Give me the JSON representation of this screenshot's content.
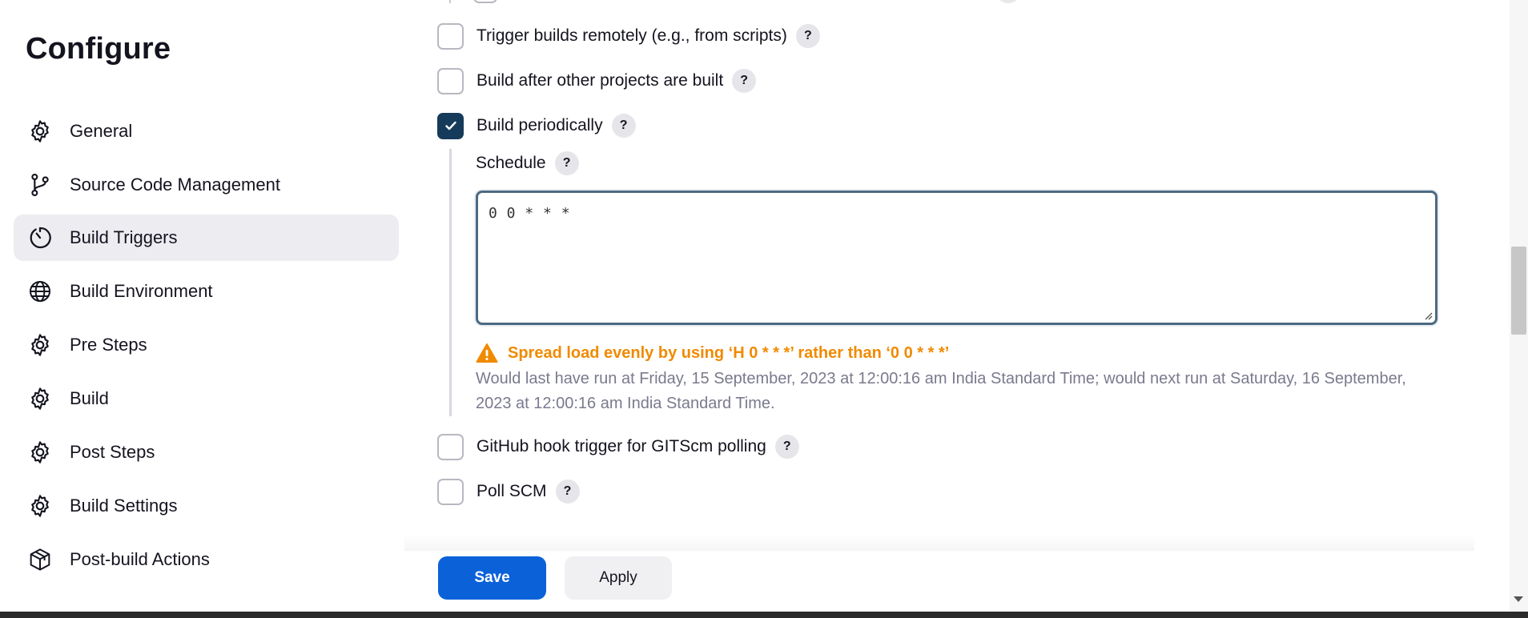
{
  "sidebar": {
    "title": "Configure",
    "items": [
      {
        "label": "General",
        "icon": "gear-icon"
      },
      {
        "label": "Source Code Management",
        "icon": "branch-icon"
      },
      {
        "label": "Build Triggers",
        "icon": "clock-icon",
        "active": true
      },
      {
        "label": "Build Environment",
        "icon": "globe-icon"
      },
      {
        "label": "Pre Steps",
        "icon": "gear-icon"
      },
      {
        "label": "Build",
        "icon": "gear-icon"
      },
      {
        "label": "Post Steps",
        "icon": "gear-icon"
      },
      {
        "label": "Build Settings",
        "icon": "gear-icon"
      },
      {
        "label": "Post-build Actions",
        "icon": "package-icon"
      }
    ]
  },
  "triggers": [
    {
      "label": "Trigger builds remotely (e.g., from scripts)",
      "checked": false,
      "help": "?"
    },
    {
      "label": "Build after other projects are built",
      "checked": false,
      "help": "?"
    },
    {
      "label": "Build periodically",
      "checked": true,
      "help": "?"
    },
    {
      "label": "GitHub hook trigger for GITScm polling",
      "checked": false,
      "help": "?"
    },
    {
      "label": "Poll SCM",
      "checked": false,
      "help": "?"
    }
  ],
  "schedule": {
    "label": "Schedule",
    "help": "?",
    "value": "0 0 * * *",
    "warning": "Spread load evenly by using ‘H 0 * * *’ rather than ‘0 0 * * *’",
    "run_info": "Would last have run at Friday, 15 September, 2023 at 12:00:16 am India Standard Time; would next run at Saturday, 16 September, 2023 at 12:00:16 am India Standard Time."
  },
  "actions": {
    "save_label": "Save",
    "apply_label": "Apply"
  },
  "colors": {
    "checkbox_checked": "#163a59",
    "save_button": "#0b61d8",
    "warning": "#f08a00",
    "active_nav": "#ececf1"
  }
}
